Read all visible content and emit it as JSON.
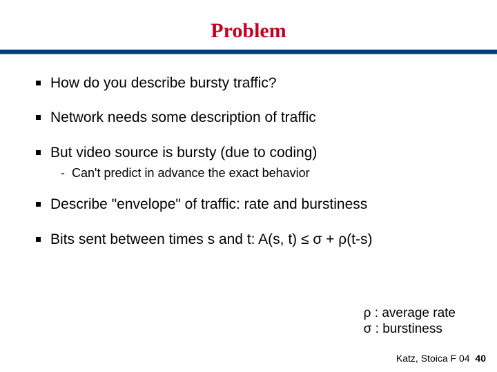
{
  "title": "Problem",
  "bullets": {
    "b0": "How do you describe bursty traffic?",
    "b1": "Network needs some description of traffic",
    "b2": "But video source is bursty (due to coding)",
    "b2_sub": "Can't predict in advance the exact behavior",
    "b3": "Describe \"envelope\" of traffic: rate and burstiness",
    "b4": "Bits sent between times s and t: A(s, t) ≤ σ + ρ(t-s)"
  },
  "legend": {
    "l0": "ρ : average rate",
    "l1": "σ : burstiness"
  },
  "footer": {
    "credit": "Katz, Stoica F 04",
    "page": "40"
  }
}
